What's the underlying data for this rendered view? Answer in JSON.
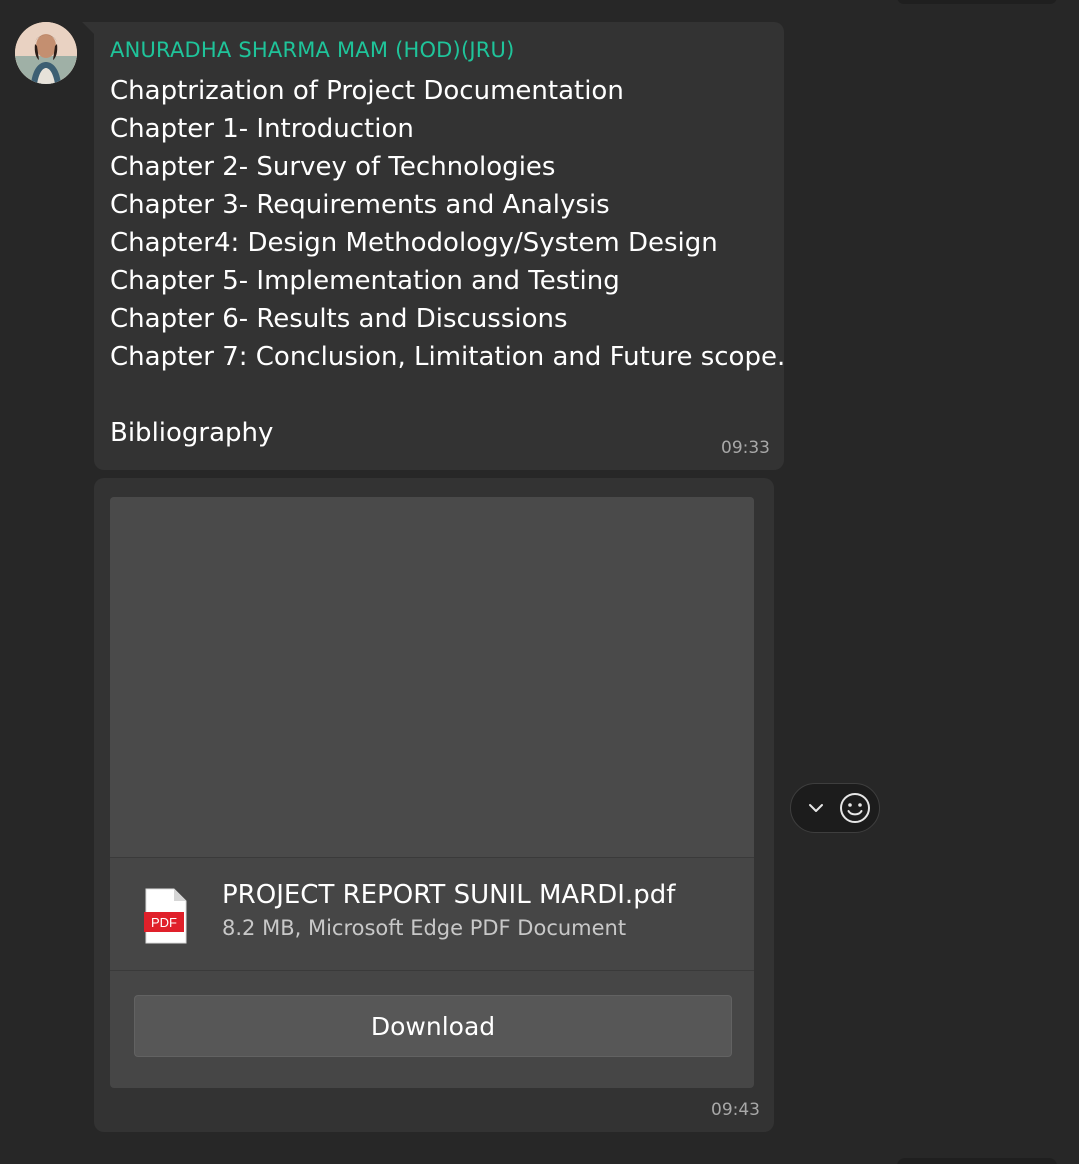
{
  "message1": {
    "sender": "ANURADHA SHARMA MAM (HOD)(JRU)",
    "lines": [
      "Chaptrization of Project Documentation",
      "Chapter 1- Introduction",
      "Chapter 2- Survey of Technologies",
      "Chapter 3- Requirements and Analysis",
      "Chapter4: Design Methodology/System Design",
      "Chapter 5- Implementation and Testing",
      "Chapter 6- Results and Discussions",
      "Chapter 7: Conclusion, Limitation and Future scope.",
      "",
      "Bibliography"
    ],
    "time": "09:33"
  },
  "message2": {
    "file_name": "PROJECT REPORT SUNIL MARDI.pdf",
    "file_meta": "8.2 MB, Microsoft Edge PDF Document",
    "file_icon": "pdf-file-icon",
    "file_icon_label": "PDF",
    "download_label": "Download",
    "time": "09:43"
  },
  "reaction_bar": {
    "chevron_icon": "chevron-down-icon",
    "emoji_icon": "smiley-icon"
  },
  "colors": {
    "sender": "#1fc49a",
    "pdf_red": "#e0202a",
    "background": "#272727",
    "bubble": "#333333"
  }
}
